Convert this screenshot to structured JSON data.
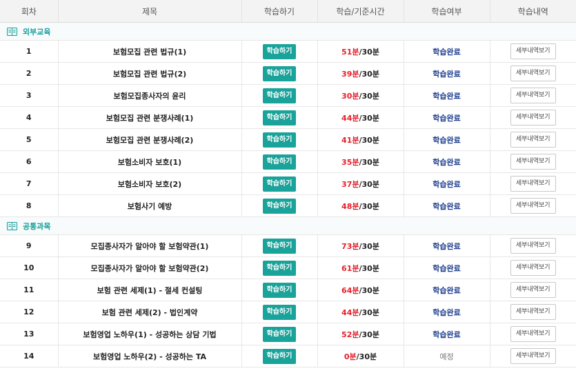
{
  "headers": [
    "회차",
    "제목",
    "학습하기",
    "학습/기준시간",
    "학습여부",
    "학습내역"
  ],
  "study_label": "학습하기",
  "detail_label": "세부내역보기",
  "sections": [
    {
      "name": "외부교육",
      "rows": [
        {
          "no": "1",
          "title": "보험모집 관련 법규(1)",
          "spent": "51분",
          "std": "/30분",
          "status": "학습완료"
        },
        {
          "no": "2",
          "title": "보험모집 관련 법규(2)",
          "spent": "39분",
          "std": "/30분",
          "status": "학습완료"
        },
        {
          "no": "3",
          "title": "보험모집종사자의 윤리",
          "spent": "30분",
          "std": "/30분",
          "status": "학습완료"
        },
        {
          "no": "4",
          "title": "보험모집 관련 분쟁사례(1)",
          "spent": "44분",
          "std": "/30분",
          "status": "학습완료"
        },
        {
          "no": "5",
          "title": "보험모집 관련 분쟁사례(2)",
          "spent": "41분",
          "std": "/30분",
          "status": "학습완료"
        },
        {
          "no": "6",
          "title": "보험소비자 보호(1)",
          "spent": "35분",
          "std": "/30분",
          "status": "학습완료"
        },
        {
          "no": "7",
          "title": "보험소비자 보호(2)",
          "spent": "37분",
          "std": "/30분",
          "status": "학습완료"
        },
        {
          "no": "8",
          "title": "보험사기 예방",
          "spent": "48분",
          "std": "/30분",
          "status": "학습완료"
        }
      ]
    },
    {
      "name": "공통과목",
      "rows": [
        {
          "no": "9",
          "title": "모집종사자가 알아야 할 보험약관(1)",
          "spent": "73분",
          "std": "/30분",
          "status": "학습완료"
        },
        {
          "no": "10",
          "title": "모집종사자가 알아야 할 보험약관(2)",
          "spent": "61분",
          "std": "/30분",
          "status": "학습완료"
        },
        {
          "no": "11",
          "title": "보험 관련 세제(1) - 절세 컨설팅",
          "spent": "64분",
          "std": "/30분",
          "status": "학습완료"
        },
        {
          "no": "12",
          "title": "보험 관련 세제(2) - 법인계약",
          "spent": "44분",
          "std": "/30분",
          "status": "학습완료"
        },
        {
          "no": "13",
          "title": "보험영업 노하우(1) - 성공하는 상담 기법",
          "spent": "52분",
          "std": "/30분",
          "status": "학습완료"
        },
        {
          "no": "14",
          "title": "보험영업 노하우(2) - 성공하는 TA",
          "spent": "0분",
          "std": "/30분",
          "status": "예정"
        }
      ]
    }
  ],
  "colors": {
    "accent": "#1aa39a",
    "time_spent": "#e5202c",
    "status_done": "#1b3c8c"
  },
  "icons": {
    "section_icon": "book-icon"
  }
}
